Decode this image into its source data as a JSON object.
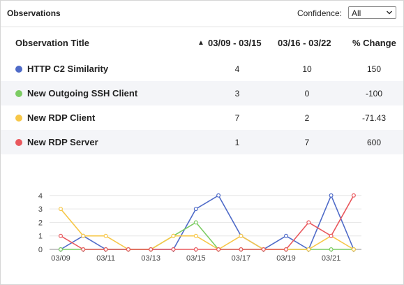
{
  "header": {
    "title": "Observations",
    "confidence_label": "Confidence:",
    "confidence_value": "All"
  },
  "table": {
    "columns": {
      "title": "Observation Title",
      "sort_arrow": "▲",
      "period1": "03/09 - 03/15",
      "period2": "03/16 - 03/22",
      "change": "% Change"
    },
    "rows": [
      {
        "name": "HTTP C2 Similarity",
        "color": "#4f6bc8",
        "p1": "4",
        "p2": "10",
        "change": "150"
      },
      {
        "name": "New Outgoing SSH Client",
        "color": "#7ccc63",
        "p1": "3",
        "p2": "0",
        "change": "-100"
      },
      {
        "name": "New RDP Client",
        "color": "#f7c748",
        "p1": "7",
        "p2": "2",
        "change": "-71.43"
      },
      {
        "name": "New RDP Server",
        "color": "#e9585d",
        "p1": "1",
        "p2": "7",
        "change": "600"
      }
    ]
  },
  "chart_data": {
    "type": "line",
    "x": [
      "03/09",
      "03/10",
      "03/11",
      "03/12",
      "03/13",
      "03/14",
      "03/15",
      "03/16",
      "03/17",
      "03/18",
      "03/19",
      "03/20",
      "03/21",
      "03/22"
    ],
    "x_tick_labels": [
      "03/09",
      "03/11",
      "03/13",
      "03/15",
      "03/17",
      "03/19",
      "03/21"
    ],
    "ylim": [
      0,
      4
    ],
    "y_ticks": [
      "0",
      "1",
      "2",
      "3",
      "4"
    ],
    "grid": true,
    "series": [
      {
        "name": "HTTP C2 Similarity",
        "color": "#4f6bc8",
        "values": [
          0,
          1,
          0,
          0,
          0,
          0,
          3,
          4,
          1,
          0,
          1,
          0,
          4,
          0
        ]
      },
      {
        "name": "New Outgoing SSH Client",
        "color": "#7ccc63",
        "values": [
          0,
          0,
          0,
          0,
          0,
          1,
          2,
          0,
          0,
          0,
          0,
          0,
          0,
          0
        ]
      },
      {
        "name": "New RDP Client",
        "color": "#f7c748",
        "values": [
          3,
          1,
          1,
          0,
          0,
          1,
          1,
          0,
          1,
          0,
          0,
          0,
          1,
          0
        ]
      },
      {
        "name": "New RDP Server",
        "color": "#e9585d",
        "values": [
          1,
          0,
          0,
          0,
          0,
          0,
          0,
          0,
          0,
          0,
          0,
          2,
          1,
          4
        ]
      }
    ]
  }
}
